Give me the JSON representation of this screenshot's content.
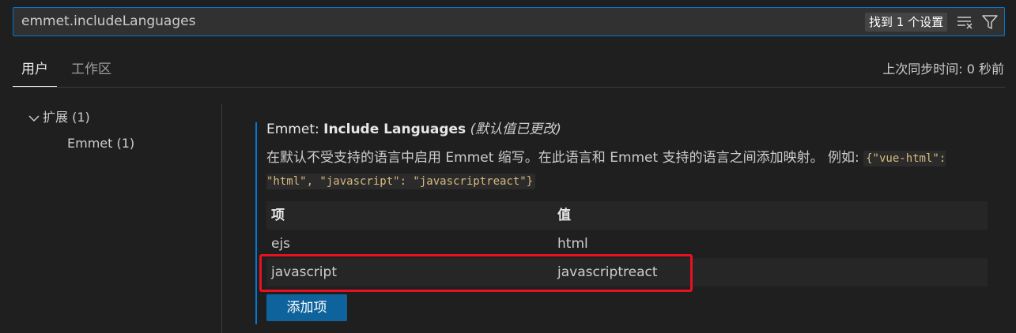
{
  "search": {
    "value": "emmet.includeLanguages",
    "result_count": "找到 1 个设置",
    "clear_icon": "clear-filter-icon",
    "filter_icon": "filter-icon"
  },
  "tabs": [
    {
      "label": "用户",
      "active": true
    },
    {
      "label": "工作区",
      "active": false
    }
  ],
  "sync_status": "上次同步时间: 0 秒前",
  "toc": {
    "extensions_label": "扩展 (1)",
    "emmet_label": "Emmet (1)",
    "chevron_icon": "chevron-down-icon"
  },
  "setting": {
    "title_category": "Emmet: ",
    "title_name": "Include Languages",
    "modified_label": "(默认值已更改)",
    "description": "在默认不受支持的语言中启用 Emmet 缩写。在此语言和 Emmet 支持的语言之间添加映射。 例如: ",
    "example_code": "{\"vue-html\": \"html\", \"javascript\": \"javascriptreact\"}",
    "table": {
      "headers": {
        "key": "项",
        "value": "值"
      },
      "rows": [
        {
          "key": "ejs",
          "value": "html"
        },
        {
          "key": "javascript",
          "value": "javascriptreact"
        }
      ]
    },
    "add_button_label": "添加项"
  },
  "colors": {
    "focus_border": "#0078d4",
    "button_bg": "#0e639c",
    "highlight": "#e81123"
  }
}
